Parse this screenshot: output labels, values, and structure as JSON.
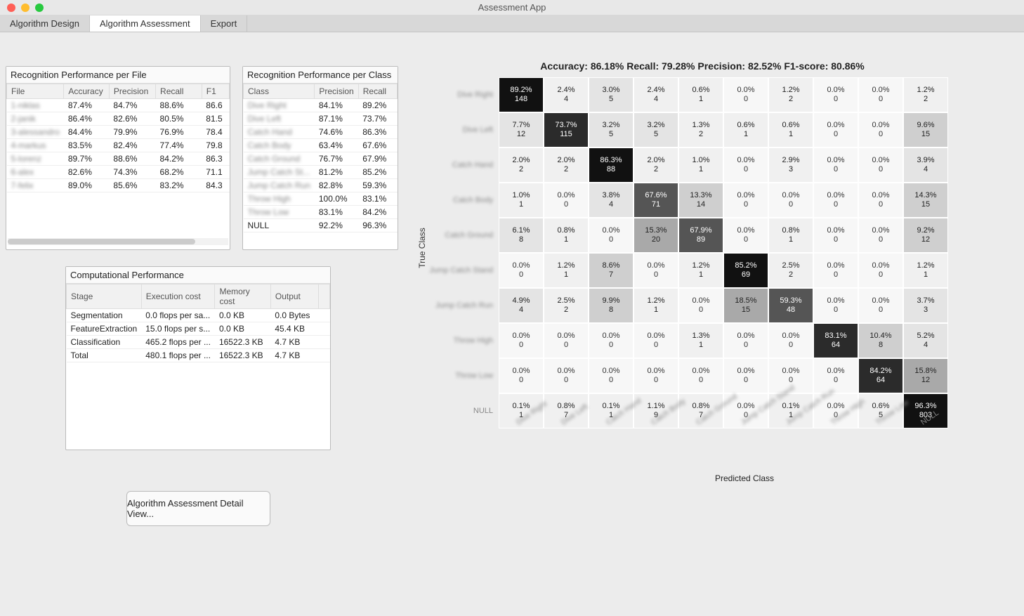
{
  "window": {
    "title": "Assessment App"
  },
  "tabs": [
    {
      "label": "Algorithm Design",
      "active": false
    },
    {
      "label": "Algorithm Assessment",
      "active": true
    },
    {
      "label": "Export",
      "active": false
    }
  ],
  "file_panel": {
    "title": "Recognition Performance per File",
    "headers": [
      "File",
      "Accuracy",
      "Precision",
      "Recall",
      "F1"
    ],
    "rows": [
      {
        "file": "1-niklas",
        "accuracy": "87.4%",
        "precision": "84.7%",
        "recall": "88.6%",
        "f1": "86.6"
      },
      {
        "file": "2-janik",
        "accuracy": "86.4%",
        "precision": "82.6%",
        "recall": "80.5%",
        "f1": "81.5"
      },
      {
        "file": "3-alessandro",
        "accuracy": "84.4%",
        "precision": "79.9%",
        "recall": "76.9%",
        "f1": "78.4"
      },
      {
        "file": "4-markus",
        "accuracy": "83.5%",
        "precision": "82.4%",
        "recall": "77.4%",
        "f1": "79.8"
      },
      {
        "file": "5-lorenz",
        "accuracy": "89.7%",
        "precision": "88.6%",
        "recall": "84.2%",
        "f1": "86.3"
      },
      {
        "file": "6-alex",
        "accuracy": "82.6%",
        "precision": "74.3%",
        "recall": "68.2%",
        "f1": "71.1"
      },
      {
        "file": "7-felix",
        "accuracy": "89.0%",
        "precision": "85.6%",
        "recall": "83.2%",
        "f1": "84.3"
      }
    ]
  },
  "class_panel": {
    "title": "Recognition Performance per Class",
    "headers": [
      "Class",
      "Precision",
      "Recall"
    ],
    "rows": [
      {
        "class": "Dive Right",
        "precision": "84.1%",
        "recall": "89.2%"
      },
      {
        "class": "Dive Left",
        "precision": "87.1%",
        "recall": "73.7%"
      },
      {
        "class": "Catch Hand",
        "precision": "74.6%",
        "recall": "86.3%"
      },
      {
        "class": "Catch Body",
        "precision": "63.4%",
        "recall": "67.6%"
      },
      {
        "class": "Catch Ground",
        "precision": "76.7%",
        "recall": "67.9%"
      },
      {
        "class": "Jump Catch St...",
        "precision": "81.2%",
        "recall": "85.2%"
      },
      {
        "class": "Jump Catch Run",
        "precision": "82.8%",
        "recall": "59.3%"
      },
      {
        "class": "Throw High",
        "precision": "100.0%",
        "recall": "83.1%"
      },
      {
        "class": "Throw Low",
        "precision": "83.1%",
        "recall": "84.2%"
      },
      {
        "class": "NULL",
        "precision": "92.2%",
        "recall": "96.3%"
      }
    ]
  },
  "comp_panel": {
    "title": "Computational Performance",
    "headers": [
      "Stage",
      "Execution cost",
      "Memory cost",
      "Output"
    ],
    "rows": [
      {
        "stage": "Segmentation",
        "exec": "0.0 flops per sa...",
        "mem": "0.0 KB",
        "out": "0.0 Bytes"
      },
      {
        "stage": "FeatureExtraction",
        "exec": "15.0 flops per s...",
        "mem": "0.0 KB",
        "out": "45.4 KB"
      },
      {
        "stage": "Classification",
        "exec": "465.2 flops per ...",
        "mem": "16522.3 KB",
        "out": "4.7 KB"
      },
      {
        "stage": "Total",
        "exec": "480.1 flops per ...",
        "mem": "16522.3 KB",
        "out": "4.7 KB"
      }
    ]
  },
  "detail_button": {
    "label": "Algorithm Assessment Detail View..."
  },
  "cm_summary": "Accuracy: 86.18% Recall: 79.28% Precision: 82.52% F1-score: 80.86%",
  "cm_axis_y": "True Class",
  "cm_axis_x": "Predicted Class",
  "chart_data": {
    "type": "heatmap",
    "title": "Accuracy: 86.18% Recall: 79.28% Precision: 82.52% F1-score: 80.86%",
    "xlabel": "Predicted Class",
    "ylabel": "True Class",
    "row_labels": [
      "Dive Right",
      "Dive Left",
      "Catch Hand",
      "Catch Body",
      "Catch Ground",
      "Jump Catch Stand",
      "Jump Catch Run",
      "Throw High",
      "Throw Low",
      "NULL"
    ],
    "col_labels": [
      "Dive Right",
      "Dive Left",
      "Catch Hand",
      "Catch Body",
      "Catch Ground",
      "Jump Catch Stand",
      "Jump Catch Run",
      "Throw High",
      "Throw Low",
      "NULL"
    ],
    "cells": [
      [
        {
          "p": "89.2%",
          "n": "148"
        },
        {
          "p": "2.4%",
          "n": "4"
        },
        {
          "p": "3.0%",
          "n": "5"
        },
        {
          "p": "2.4%",
          "n": "4"
        },
        {
          "p": "0.6%",
          "n": "1"
        },
        {
          "p": "0.0%",
          "n": "0"
        },
        {
          "p": "1.2%",
          "n": "2"
        },
        {
          "p": "0.0%",
          "n": "0"
        },
        {
          "p": "0.0%",
          "n": "0"
        },
        {
          "p": "1.2%",
          "n": "2"
        }
      ],
      [
        {
          "p": "7.7%",
          "n": "12"
        },
        {
          "p": "73.7%",
          "n": "115"
        },
        {
          "p": "3.2%",
          "n": "5"
        },
        {
          "p": "3.2%",
          "n": "5"
        },
        {
          "p": "1.3%",
          "n": "2"
        },
        {
          "p": "0.6%",
          "n": "1"
        },
        {
          "p": "0.6%",
          "n": "1"
        },
        {
          "p": "0.0%",
          "n": "0"
        },
        {
          "p": "0.0%",
          "n": "0"
        },
        {
          "p": "9.6%",
          "n": "15"
        }
      ],
      [
        {
          "p": "2.0%",
          "n": "2"
        },
        {
          "p": "2.0%",
          "n": "2"
        },
        {
          "p": "86.3%",
          "n": "88"
        },
        {
          "p": "2.0%",
          "n": "2"
        },
        {
          "p": "1.0%",
          "n": "1"
        },
        {
          "p": "0.0%",
          "n": "0"
        },
        {
          "p": "2.9%",
          "n": "3"
        },
        {
          "p": "0.0%",
          "n": "0"
        },
        {
          "p": "0.0%",
          "n": "0"
        },
        {
          "p": "3.9%",
          "n": "4"
        }
      ],
      [
        {
          "p": "1.0%",
          "n": "1"
        },
        {
          "p": "0.0%",
          "n": "0"
        },
        {
          "p": "3.8%",
          "n": "4"
        },
        {
          "p": "67.6%",
          "n": "71"
        },
        {
          "p": "13.3%",
          "n": "14"
        },
        {
          "p": "0.0%",
          "n": "0"
        },
        {
          "p": "0.0%",
          "n": "0"
        },
        {
          "p": "0.0%",
          "n": "0"
        },
        {
          "p": "0.0%",
          "n": "0"
        },
        {
          "p": "14.3%",
          "n": "15"
        }
      ],
      [
        {
          "p": "6.1%",
          "n": "8"
        },
        {
          "p": "0.8%",
          "n": "1"
        },
        {
          "p": "0.0%",
          "n": "0"
        },
        {
          "p": "15.3%",
          "n": "20"
        },
        {
          "p": "67.9%",
          "n": "89"
        },
        {
          "p": "0.0%",
          "n": "0"
        },
        {
          "p": "0.8%",
          "n": "1"
        },
        {
          "p": "0.0%",
          "n": "0"
        },
        {
          "p": "0.0%",
          "n": "0"
        },
        {
          "p": "9.2%",
          "n": "12"
        }
      ],
      [
        {
          "p": "0.0%",
          "n": "0"
        },
        {
          "p": "1.2%",
          "n": "1"
        },
        {
          "p": "8.6%",
          "n": "7"
        },
        {
          "p": "0.0%",
          "n": "0"
        },
        {
          "p": "1.2%",
          "n": "1"
        },
        {
          "p": "85.2%",
          "n": "69"
        },
        {
          "p": "2.5%",
          "n": "2"
        },
        {
          "p": "0.0%",
          "n": "0"
        },
        {
          "p": "0.0%",
          "n": "0"
        },
        {
          "p": "1.2%",
          "n": "1"
        }
      ],
      [
        {
          "p": "4.9%",
          "n": "4"
        },
        {
          "p": "2.5%",
          "n": "2"
        },
        {
          "p": "9.9%",
          "n": "8"
        },
        {
          "p": "1.2%",
          "n": "1"
        },
        {
          "p": "0.0%",
          "n": "0"
        },
        {
          "p": "18.5%",
          "n": "15"
        },
        {
          "p": "59.3%",
          "n": "48"
        },
        {
          "p": "0.0%",
          "n": "0"
        },
        {
          "p": "0.0%",
          "n": "0"
        },
        {
          "p": "3.7%",
          "n": "3"
        }
      ],
      [
        {
          "p": "0.0%",
          "n": "0"
        },
        {
          "p": "0.0%",
          "n": "0"
        },
        {
          "p": "0.0%",
          "n": "0"
        },
        {
          "p": "0.0%",
          "n": "0"
        },
        {
          "p": "1.3%",
          "n": "1"
        },
        {
          "p": "0.0%",
          "n": "0"
        },
        {
          "p": "0.0%",
          "n": "0"
        },
        {
          "p": "83.1%",
          "n": "64"
        },
        {
          "p": "10.4%",
          "n": "8"
        },
        {
          "p": "5.2%",
          "n": "4"
        }
      ],
      [
        {
          "p": "0.0%",
          "n": "0"
        },
        {
          "p": "0.0%",
          "n": "0"
        },
        {
          "p": "0.0%",
          "n": "0"
        },
        {
          "p": "0.0%",
          "n": "0"
        },
        {
          "p": "0.0%",
          "n": "0"
        },
        {
          "p": "0.0%",
          "n": "0"
        },
        {
          "p": "0.0%",
          "n": "0"
        },
        {
          "p": "0.0%",
          "n": "0"
        },
        {
          "p": "84.2%",
          "n": "64"
        },
        {
          "p": "15.8%",
          "n": "12"
        }
      ],
      [
        {
          "p": "0.1%",
          "n": "1"
        },
        {
          "p": "0.8%",
          "n": "7"
        },
        {
          "p": "0.1%",
          "n": "1"
        },
        {
          "p": "1.1%",
          "n": "9"
        },
        {
          "p": "0.8%",
          "n": "7"
        },
        {
          "p": "0.0%",
          "n": "0"
        },
        {
          "p": "0.1%",
          "n": "1"
        },
        {
          "p": "0.0%",
          "n": "0"
        },
        {
          "p": "0.6%",
          "n": "5"
        },
        {
          "p": "96.3%",
          "n": "803"
        }
      ]
    ]
  }
}
